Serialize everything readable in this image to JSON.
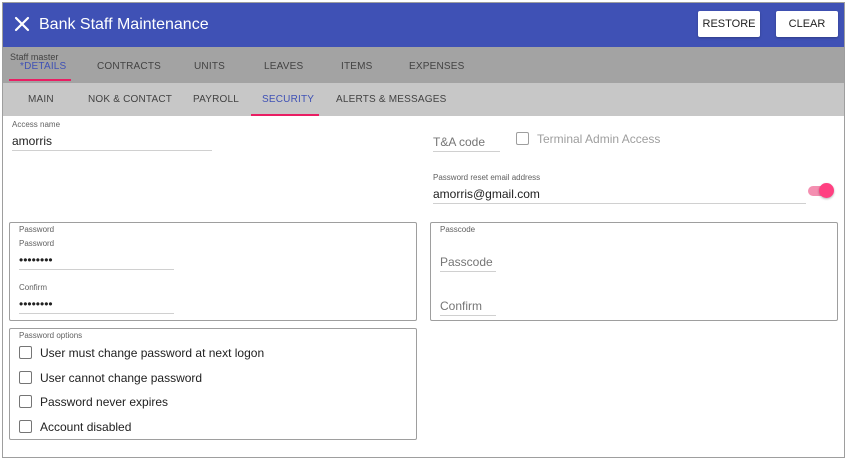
{
  "window": {
    "title": "Bank Staff Maintenance",
    "close_icon": "close-icon"
  },
  "toolbar": {
    "restore_label": "RESTORE",
    "clear_label": "CLEAR"
  },
  "primary_tabs": {
    "section_label": "Staff master",
    "items": [
      {
        "label": "*DETAILS",
        "active": true
      },
      {
        "label": "CONTRACTS"
      },
      {
        "label": "UNITS"
      },
      {
        "label": "LEAVES"
      },
      {
        "label": "ITEMS"
      },
      {
        "label": "EXPENSES"
      }
    ]
  },
  "secondary_tabs": {
    "items": [
      {
        "label": "MAIN"
      },
      {
        "label": "NOK & CONTACT"
      },
      {
        "label": "PAYROLL"
      },
      {
        "label": "SECURITY",
        "active": true
      },
      {
        "label": "ALERTS & MESSAGES"
      }
    ]
  },
  "access": {
    "label": "Access name",
    "value": "amorris"
  },
  "ta_code": {
    "placeholder": "T&A code"
  },
  "terminal_admin": {
    "label": "Terminal Admin Access",
    "checked": false
  },
  "reset_email": {
    "label": "Password reset email address",
    "value": "amorris@gmail.com",
    "toggle_on": true
  },
  "password_group": {
    "title": "Password",
    "password_label": "Password",
    "password_value": "••••••••",
    "confirm_label": "Confirm",
    "confirm_value": "••••••••"
  },
  "passcode_group": {
    "title": "Passcode",
    "passcode_placeholder": "Passcode",
    "confirm_placeholder": "Confirm"
  },
  "password_options": {
    "title": "Password options",
    "items": [
      {
        "label": "User must change password at next logon",
        "checked": false
      },
      {
        "label": "User cannot change password",
        "checked": false
      },
      {
        "label": "Password never expires",
        "checked": false
      },
      {
        "label": "Account disabled",
        "checked": false
      }
    ]
  },
  "colors": {
    "header": "#3f51b5",
    "accent": "#e91e63",
    "primary_tab_bg": "#a3a3a3",
    "secondary_tab_bg": "#c7c7c7"
  }
}
